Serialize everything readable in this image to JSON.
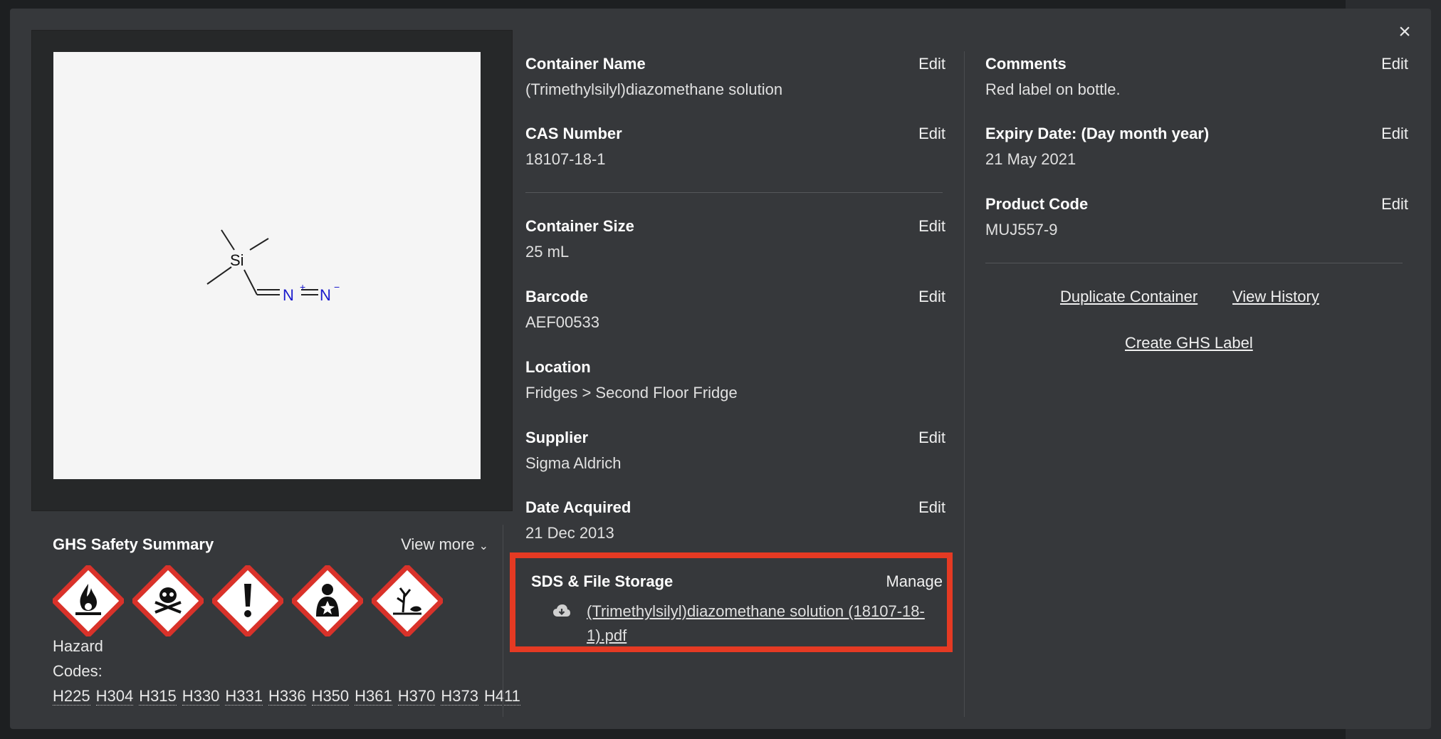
{
  "modal": {
    "close_label": "×"
  },
  "ghs": {
    "title": "GHS Safety Summary",
    "view_more": "View more",
    "hazard_label": "Hazard",
    "codes_label": "Codes:",
    "codes": [
      "H225",
      "H304",
      "H315",
      "H330",
      "H331",
      "H336",
      "H350",
      "H361",
      "H370",
      "H373",
      "H411"
    ],
    "pictograms": [
      "flame-icon",
      "skull-crossbones-icon",
      "exclamation-icon",
      "health-hazard-icon",
      "environment-icon"
    ]
  },
  "structure": {
    "atom_si": "Si",
    "atom_n1": "N",
    "charge_n1": "+",
    "atom_n2": "N",
    "charge_n2": "−"
  },
  "fields": {
    "container_name": {
      "label": "Container Name",
      "value": "(Trimethylsilyl)diazomethane solution",
      "edit": "Edit"
    },
    "cas_number": {
      "label": "CAS Number",
      "value": "18107-18-1",
      "edit": "Edit"
    },
    "container_size": {
      "label": "Container Size",
      "value": "25 mL",
      "edit": "Edit"
    },
    "barcode": {
      "label": "Barcode",
      "value": "AEF00533",
      "edit": "Edit"
    },
    "location": {
      "label": "Location",
      "value": "Fridges > Second Floor Fridge"
    },
    "supplier": {
      "label": "Supplier",
      "value": "Sigma Aldrich",
      "edit": "Edit"
    },
    "date_acquired": {
      "label": "Date Acquired",
      "value": "21 Dec 2013",
      "edit": "Edit"
    },
    "comments": {
      "label": "Comments",
      "value": "Red label on bottle.",
      "edit": "Edit"
    },
    "expiry_date": {
      "label": "Expiry Date: (Day month year)",
      "value": "21 May 2021",
      "edit": "Edit"
    },
    "product_code": {
      "label": "Product Code",
      "value": "MUJ557-9",
      "edit": "Edit"
    }
  },
  "sds": {
    "label": "SDS & File Storage",
    "manage": "Manage",
    "file_name": "(Trimethylsilyl)diazomethane solution (18107-18-1).pdf",
    "highlight_color": "#e53a23"
  },
  "actions": {
    "duplicate": "Duplicate Container",
    "history": "View History",
    "ghs_label": "Create GHS Label"
  }
}
